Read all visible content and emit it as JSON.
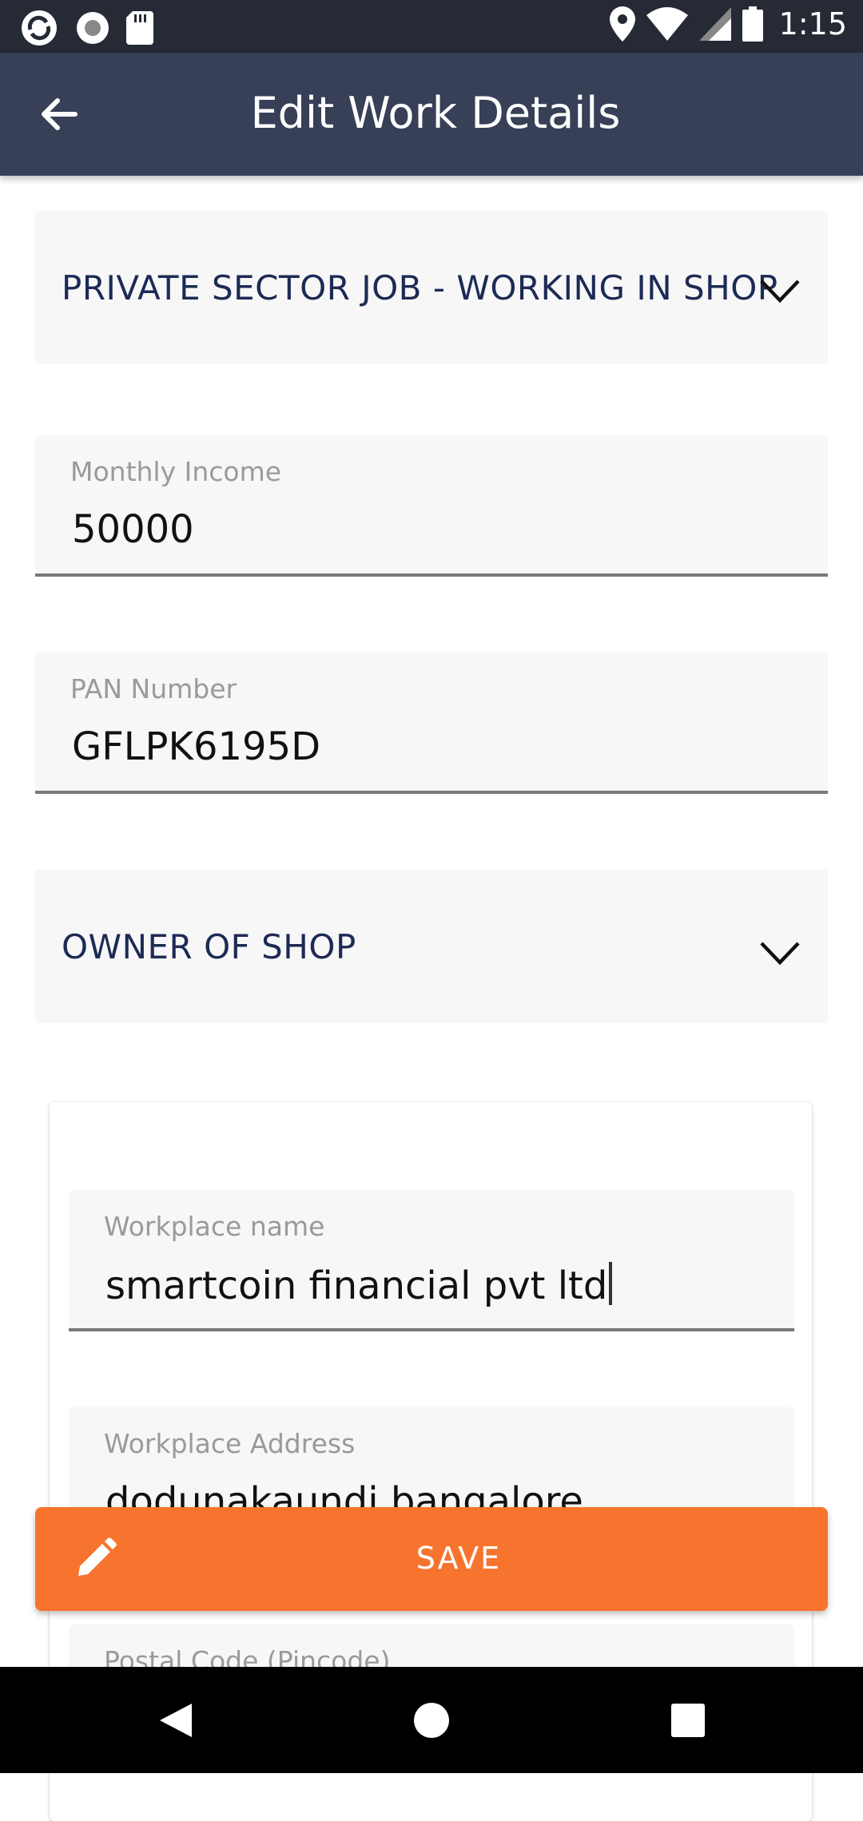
{
  "status_bar": {
    "time": "1:15"
  },
  "app_bar": {
    "title": "Edit Work Details"
  },
  "employment_type": {
    "selected": "PRIVATE SECTOR JOB - WORKING IN SHOP"
  },
  "monthly_income": {
    "label": "Monthly Income",
    "value": "50000"
  },
  "pan_number": {
    "label": "PAN Number",
    "value": "GFLPK6195D"
  },
  "designation": {
    "selected": "OWNER OF SHOP"
  },
  "workplace_name": {
    "label": "Workplace name",
    "value": "smartcoin financial pvt ltd"
  },
  "workplace_address": {
    "label": "Workplace Address",
    "value": "dodunakaundi bangalore"
  },
  "postal_code": {
    "label": "Postal Code (Pincode)"
  },
  "save_button": {
    "label": "SAVE"
  },
  "colors": {
    "app_bar": "#374057",
    "status_bar": "#262a35",
    "accent": "#f7742e",
    "select_text": "#1d2a55"
  }
}
